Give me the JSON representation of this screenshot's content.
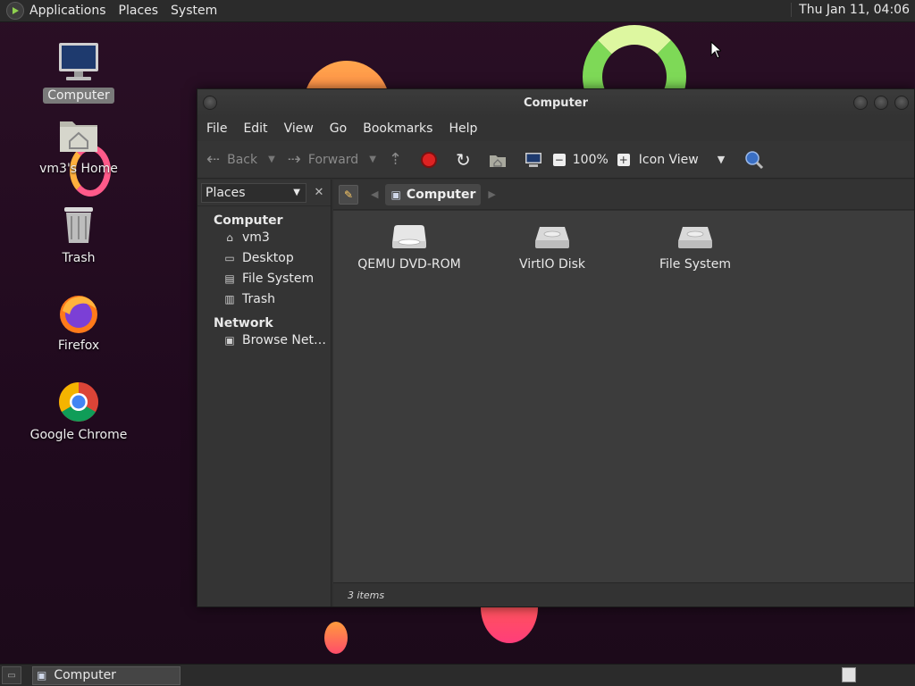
{
  "top_panel": {
    "menus": [
      "Applications",
      "Places",
      "System"
    ],
    "clock": "Thu Jan 11, 04:06"
  },
  "desktop": {
    "icons": [
      {
        "label": "Computer",
        "icon": "computer-icon",
        "selected": true
      },
      {
        "label": "vm3's Home",
        "icon": "home-folder-icon"
      },
      {
        "label": "Trash",
        "icon": "trash-icon"
      },
      {
        "label": "Firefox",
        "icon": "firefox-icon"
      },
      {
        "label": "Google Chrome",
        "icon": "chrome-icon"
      }
    ]
  },
  "window": {
    "title": "Computer",
    "menu": [
      "File",
      "Edit",
      "View",
      "Go",
      "Bookmarks",
      "Help"
    ],
    "toolbar": {
      "back": "Back",
      "forward": "Forward",
      "zoom": "100%",
      "view_mode": "Icon View"
    },
    "sidebar": {
      "selector": "Places",
      "sections": [
        {
          "title": "Computer",
          "items": [
            {
              "label": "vm3",
              "icon": "home-icon"
            },
            {
              "label": "Desktop",
              "icon": "desktop-icon"
            },
            {
              "label": "File System",
              "icon": "drive-icon"
            },
            {
              "label": "Trash",
              "icon": "trash-icon"
            }
          ]
        },
        {
          "title": "Network",
          "items": [
            {
              "label": "Browse Net…",
              "icon": "network-icon"
            }
          ]
        }
      ]
    },
    "location": {
      "crumb": "Computer"
    },
    "files": [
      {
        "label": "QEMU DVD-ROM",
        "icon": "optical-drive-icon"
      },
      {
        "label": "VirtIO Disk",
        "icon": "hard-disk-icon"
      },
      {
        "label": "File System",
        "icon": "hard-disk-icon"
      }
    ],
    "status": "3 items"
  },
  "bottom_panel": {
    "task": "Computer"
  },
  "colors": {
    "desktop_bg": "#220c20",
    "panel": "#2b2b2b",
    "window": "#2f2f2f",
    "content": "#3c3c3c"
  }
}
